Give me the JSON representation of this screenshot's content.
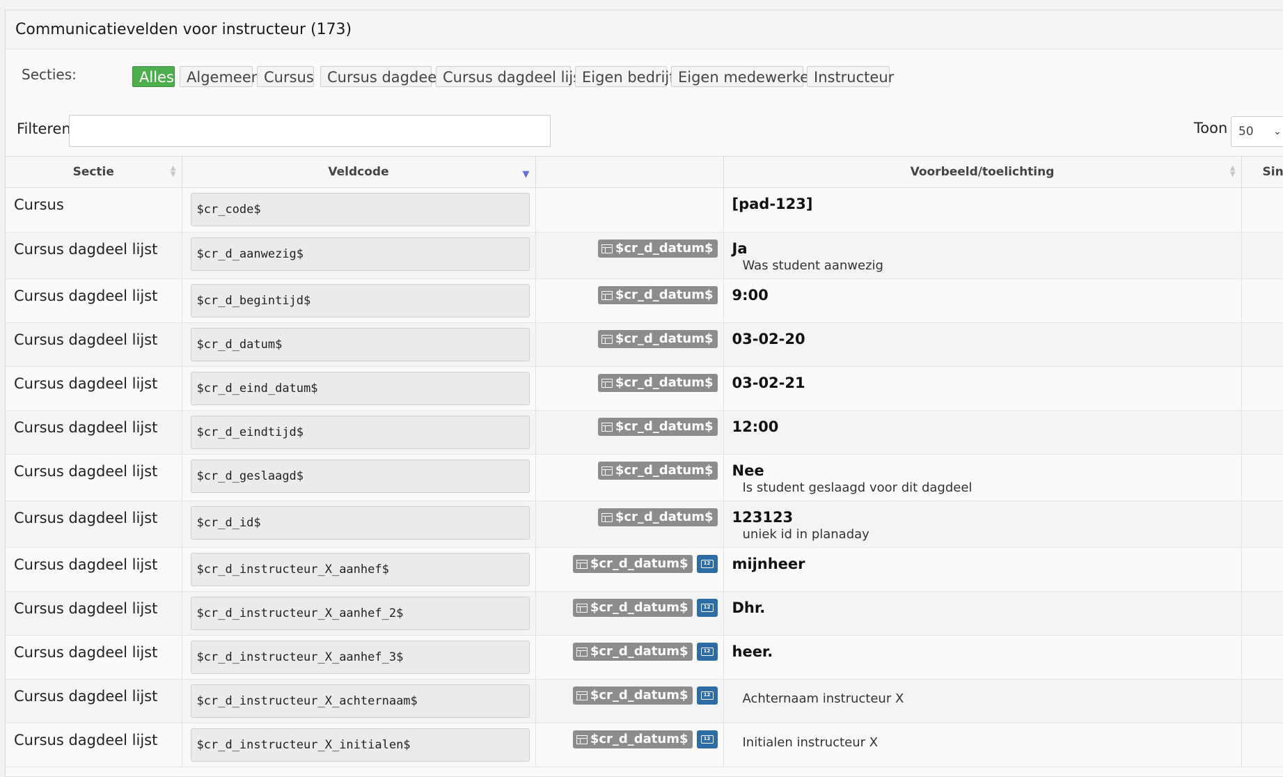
{
  "panel": {
    "title": "Communicatievelden voor instructeur (173)"
  },
  "sections": {
    "label": "Secties:",
    "buttons": [
      "Alles",
      "Algemeen",
      "Cursus",
      "Cursus dagdeel",
      "Cursus dagdeel lijst",
      "Eigen bedrijf",
      "Eigen medewerker",
      "Instructeur"
    ],
    "active": "Alles"
  },
  "filter": {
    "label": "Filteren",
    "value": ""
  },
  "toon": {
    "label": "Toon",
    "value": "50"
  },
  "table": {
    "headers": {
      "sectie": "Sectie",
      "veldcode": "Veldcode",
      "context": "",
      "voorbeeld": "Voorbeeld/toelichting",
      "extra": "Sinc"
    },
    "rows": [
      {
        "sectie": "Cursus",
        "code": "$cr_code$",
        "ctx": "",
        "numeric": false,
        "example": "[pad-123]",
        "desc": ""
      },
      {
        "sectie": "Cursus dagdeel lijst",
        "code": "$cr_d_aanwezig$",
        "ctx": "$cr_d_datum$",
        "numeric": false,
        "example": "Ja",
        "desc": "Was student aanwezig"
      },
      {
        "sectie": "Cursus dagdeel lijst",
        "code": "$cr_d_begintijd$",
        "ctx": "$cr_d_datum$",
        "numeric": false,
        "example": "9:00",
        "desc": ""
      },
      {
        "sectie": "Cursus dagdeel lijst",
        "code": "$cr_d_datum$",
        "ctx": "$cr_d_datum$",
        "numeric": false,
        "example": "03-02-20",
        "desc": ""
      },
      {
        "sectie": "Cursus dagdeel lijst",
        "code": "$cr_d_eind_datum$",
        "ctx": "$cr_d_datum$",
        "numeric": false,
        "example": "03-02-21",
        "desc": ""
      },
      {
        "sectie": "Cursus dagdeel lijst",
        "code": "$cr_d_eindtijd$",
        "ctx": "$cr_d_datum$",
        "numeric": false,
        "example": "12:00",
        "desc": ""
      },
      {
        "sectie": "Cursus dagdeel lijst",
        "code": "$cr_d_geslaagd$",
        "ctx": "$cr_d_datum$",
        "numeric": false,
        "example": "Nee",
        "desc": "Is student geslaagd voor dit dagdeel"
      },
      {
        "sectie": "Cursus dagdeel lijst",
        "code": "$cr_d_id$",
        "ctx": "$cr_d_datum$",
        "numeric": false,
        "example": "123123",
        "desc": "uniek id in planaday"
      },
      {
        "sectie": "Cursus dagdeel lijst",
        "code": "$cr_d_instructeur_X_aanhef$",
        "ctx": "$cr_d_datum$",
        "numeric": true,
        "example": "mijnheer",
        "desc": ""
      },
      {
        "sectie": "Cursus dagdeel lijst",
        "code": "$cr_d_instructeur_X_aanhef_2$",
        "ctx": "$cr_d_datum$",
        "numeric": true,
        "example": "Dhr.",
        "desc": ""
      },
      {
        "sectie": "Cursus dagdeel lijst",
        "code": "$cr_d_instructeur_X_aanhef_3$",
        "ctx": "$cr_d_datum$",
        "numeric": true,
        "example": "heer.",
        "desc": ""
      },
      {
        "sectie": "Cursus dagdeel lijst",
        "code": "$cr_d_instructeur_X_achternaam$",
        "ctx": "$cr_d_datum$",
        "numeric": true,
        "example": "",
        "desc": "Achternaam instructeur X"
      },
      {
        "sectie": "Cursus dagdeel lijst",
        "code": "$cr_d_instructeur_X_initialen$",
        "ctx": "$cr_d_datum$",
        "numeric": true,
        "example": "",
        "desc": "Initialen instructeur X"
      }
    ]
  }
}
